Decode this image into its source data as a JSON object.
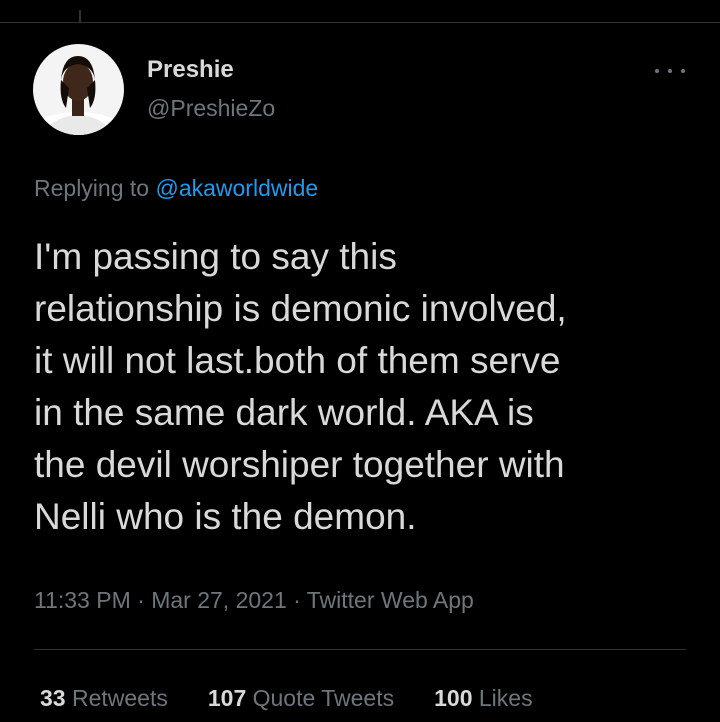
{
  "author": {
    "display_name": "Preshie",
    "handle": "@PreshieZo"
  },
  "reply": {
    "prefix": "Replying to ",
    "mention": "@akaworldwide"
  },
  "tweet": {
    "text": "I'm passing to say this\nrelationship is demonic involved,\nit will not last.both of them serve\nin the same dark world. AKA is\nthe devil worshiper together with\nNelli who is the demon."
  },
  "meta": {
    "time": "11:33 PM",
    "separator": "·",
    "date": "Mar 27, 2021",
    "source": "Twitter Web App"
  },
  "stats": {
    "retweets_count": "33",
    "retweets_label": "Retweets",
    "quotes_count": "107",
    "quotes_label": "Quote Tweets",
    "likes_count": "100",
    "likes_label": "Likes"
  },
  "icons": {
    "more": "more-horizontal-icon"
  },
  "colors": {
    "background": "#000000",
    "text": "#d9d9d9",
    "secondary": "#6e767d",
    "link": "#1d9bf0",
    "divider": "#2f3336"
  }
}
